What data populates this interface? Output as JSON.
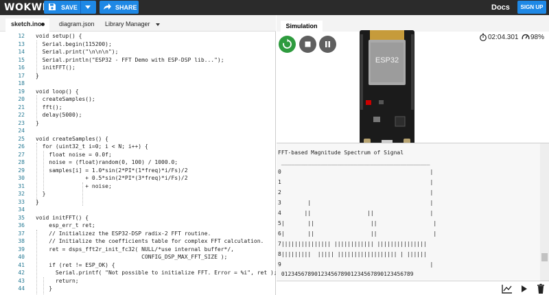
{
  "header": {
    "logo": "WOKWI",
    "save_label": "SAVE",
    "share_label": "SHARE",
    "docs_label": "Docs",
    "signup_label": "SIGN UP"
  },
  "editor": {
    "tabs": [
      "sketch.ino",
      "diagram.json",
      "Library Manager"
    ],
    "lines": [
      {
        "n": "12",
        "t": "void setup() {"
      },
      {
        "n": "13",
        "t": "  Serial.begin(115200);"
      },
      {
        "n": "14",
        "t": "  Serial.print(\"\\n\\n\\n\");"
      },
      {
        "n": "15",
        "t": "  Serial.println(\"ESP32 - FFT Demo with ESP-DSP lib...\");"
      },
      {
        "n": "16",
        "t": "  initFFT();"
      },
      {
        "n": "17",
        "t": "}"
      },
      {
        "n": "18",
        "t": ""
      },
      {
        "n": "19",
        "t": "void loop() {"
      },
      {
        "n": "20",
        "t": "  createSamples();"
      },
      {
        "n": "21",
        "t": "  fft();"
      },
      {
        "n": "22",
        "t": "  delay(5000);"
      },
      {
        "n": "23",
        "t": "}"
      },
      {
        "n": "24",
        "t": ""
      },
      {
        "n": "25",
        "t": "void createSamples() {"
      },
      {
        "n": "26",
        "t": "  for (uint32_t i=0; i < N; i++) {"
      },
      {
        "n": "27",
        "t": "    float noise = 0.0f;"
      },
      {
        "n": "28",
        "t": "    noise = (float)random(0, 100) / 1000.0;"
      },
      {
        "n": "29",
        "t": "    samples[i] = 1.0*sin(2*PI*(1*freq)*i/Fs)/2"
      },
      {
        "n": "30",
        "t": "               + 0.5*sin(2*PI*(3*freq)*i/Fs)/2"
      },
      {
        "n": "31",
        "t": "               + noise;"
      },
      {
        "n": "32",
        "t": "  }"
      },
      {
        "n": "33",
        "t": "}"
      },
      {
        "n": "34",
        "t": ""
      },
      {
        "n": "35",
        "t": "void initFFT() {"
      },
      {
        "n": "36",
        "t": "    esp_err_t ret;"
      },
      {
        "n": "37",
        "t": "    // Initializez the ESP32-DSP radix-2 FFT routine."
      },
      {
        "n": "38",
        "t": "    // Initialize the coefficients table for complex FFT calculation."
      },
      {
        "n": "39",
        "t": "    ret = dsps_fft2r_init_fc32( NULL/*use internal buffer*/,"
      },
      {
        "n": "40",
        "t": "                                CONFIG_DSP_MAX_FFT_SIZE );"
      },
      {
        "n": "41",
        "t": "    if (ret != ESP_OK) {"
      },
      {
        "n": "42",
        "t": "      Serial.printf( \"Not possible to initialize FFT. Error = %i\", ret );"
      },
      {
        "n": "43",
        "t": "      return;"
      },
      {
        "n": "44",
        "t": "    }"
      }
    ]
  },
  "simulation": {
    "tab_label": "Simulation",
    "timer": "02:04.301",
    "speed": "98%",
    "board_label": "ESP32"
  },
  "serial": {
    "lines": [
      "FFT-based Magnitude Spectrum of Signal",
      " _____________________________________________",
      "0                                             |",
      "1                                             |",
      "2                                             |",
      "3        |                                    |",
      "4       ||                 ||                 |",
      "5|       ||                 ||                 |",
      "6|       ||                 ||                 |",
      "7||||||||||||||| |||||||||||| |||||||||||||||",
      "8|||||||||  ||||| |||||||||||||||||| | ||||||",
      "9                                             |",
      " 0123456789012345678901234567890123456789"
    ]
  }
}
